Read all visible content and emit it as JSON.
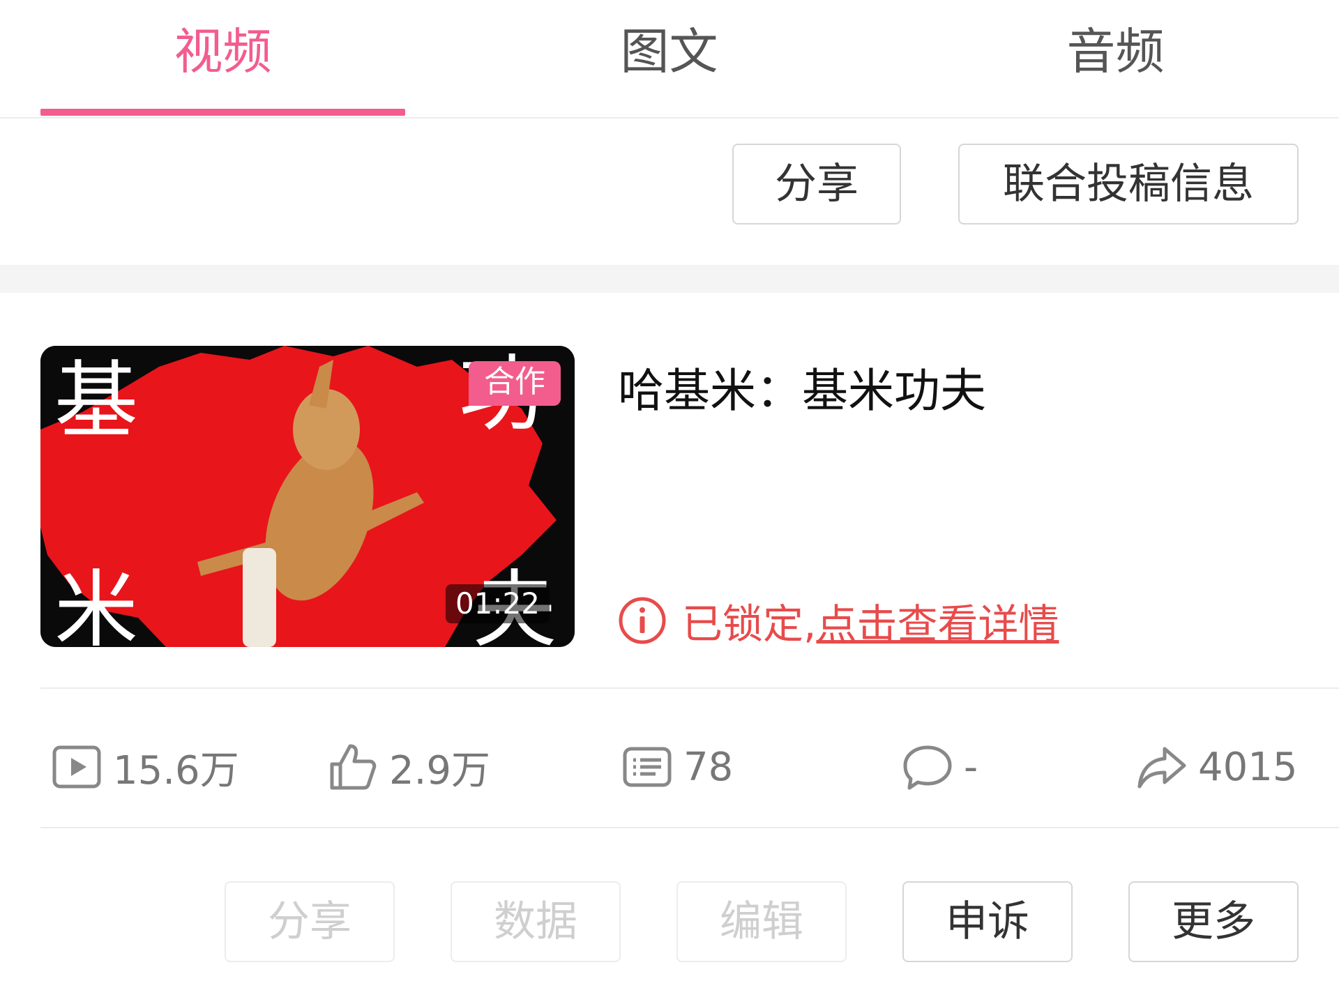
{
  "tabs": [
    {
      "label": "视频",
      "active": true
    },
    {
      "label": "图文",
      "active": false
    },
    {
      "label": "音频",
      "active": false
    }
  ],
  "top_actions": {
    "share_label": "分享",
    "joint_info_label": "联合投稿信息"
  },
  "video": {
    "thumbnail_caption_left_top": "基",
    "thumbnail_caption_left_bottom": "米",
    "thumbnail_caption_right_top": "功",
    "thumbnail_caption_right_bottom": "夫",
    "coop_badge": "合作",
    "duration": "01:22",
    "title": "哈基米：基米功夫",
    "lock_status_prefix": "已锁定,",
    "lock_status_link": "点击查看详情",
    "colors": {
      "accent": "#f25d8e",
      "lock": "#e84b4b",
      "thumb_red": "#e8151b"
    }
  },
  "stats": [
    {
      "icon": "play-icon",
      "value": "15.6万"
    },
    {
      "icon": "thumbs-up-icon",
      "value": "2.9万"
    },
    {
      "icon": "danmaku-icon",
      "value": "78"
    },
    {
      "icon": "comment-icon",
      "value": "-"
    },
    {
      "icon": "share-arrow-icon",
      "value": "4015"
    }
  ],
  "bottom_actions": [
    {
      "label": "分享",
      "enabled": false
    },
    {
      "label": "数据",
      "enabled": false
    },
    {
      "label": "编辑",
      "enabled": false
    },
    {
      "label": "申诉",
      "enabled": true
    },
    {
      "label": "更多",
      "enabled": true
    }
  ]
}
